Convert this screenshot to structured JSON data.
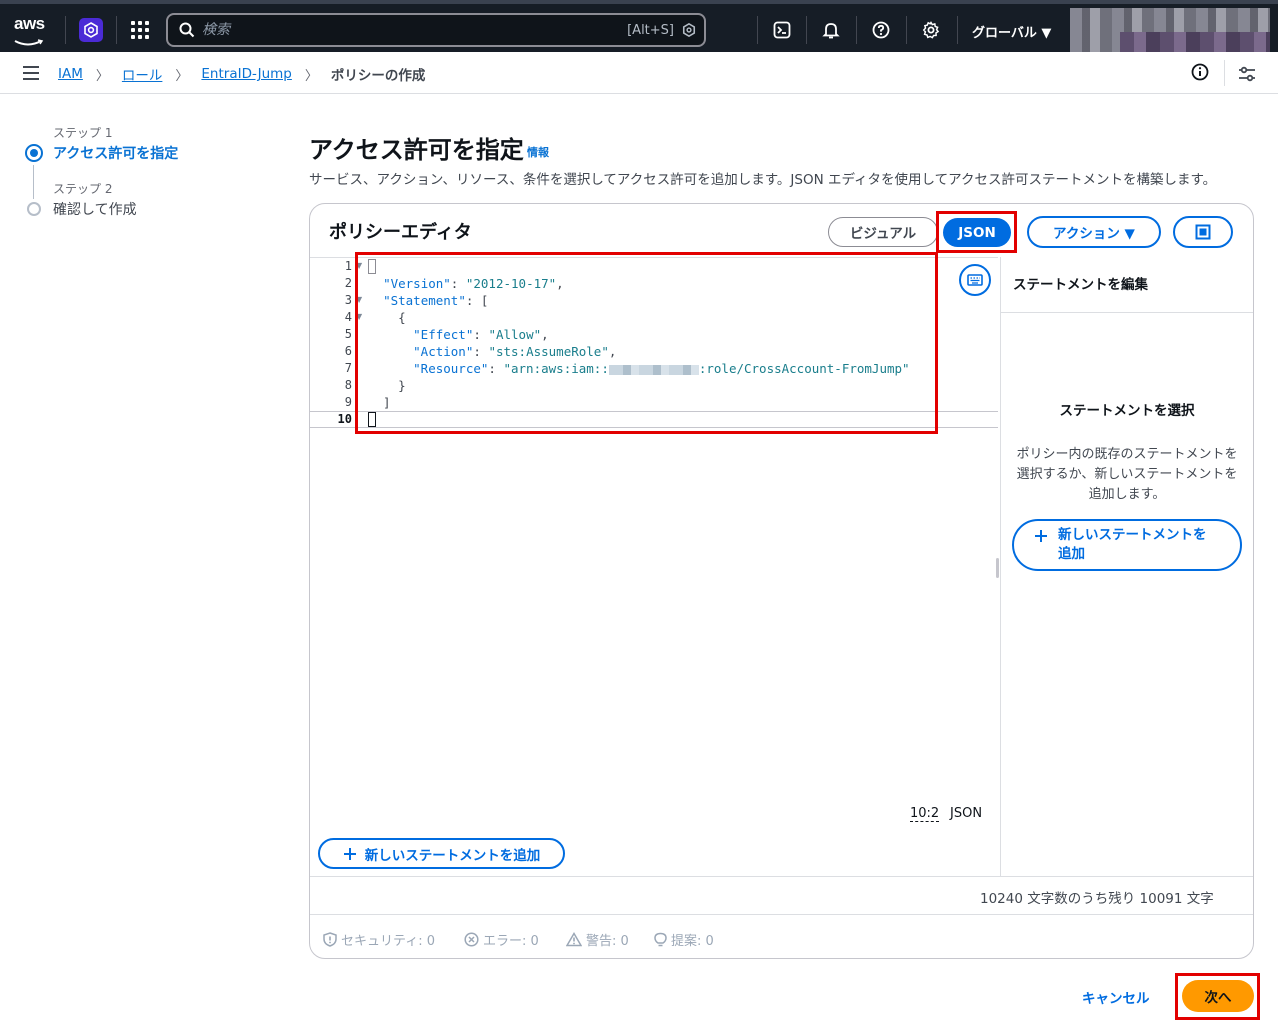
{
  "topnav": {
    "logo_text": "aws",
    "search_placeholder": "検索",
    "search_shortcut": "[Alt+S]",
    "region_label": "グローバル ▼"
  },
  "breadcrumb": {
    "items": [
      "IAM",
      "ロール",
      "EntraID-Jump"
    ],
    "current": "ポリシーの作成"
  },
  "steps": [
    {
      "number_label": "ステップ 1",
      "title": "アクセス許可を指定",
      "active": true
    },
    {
      "number_label": "ステップ 2",
      "title": "確認して作成",
      "active": false
    }
  ],
  "header": {
    "title": "アクセス許可を指定",
    "info_link": "情報",
    "description": "サービス、アクション、リソース、条件を選択してアクセス許可を追加します。JSON エディタを使用してアクセス許可ステートメントを構築します。"
  },
  "editor": {
    "heading": "ポリシーエディタ",
    "mode_visual": "ビジュアル",
    "mode_json": "JSON",
    "selected_mode": "JSON",
    "actions_label": "アクション ▼",
    "line_numbers": [
      "1",
      "2",
      "3",
      "4",
      "5",
      "6",
      "7",
      "8",
      "9",
      "10"
    ],
    "code": {
      "version_key": "\"Version\"",
      "version_val": "\"2012-10-17\"",
      "statement_key": "\"Statement\"",
      "effect_key": "\"Effect\"",
      "effect_val": "\"Allow\"",
      "action_key": "\"Action\"",
      "action_val": "\"sts:AssumeRole\"",
      "resource_key": "\"Resource\"",
      "resource_prefix": "\"arn:aws:iam::",
      "resource_suffix": ":role/CrossAccount-FromJump\""
    },
    "cursor_position": "10:2",
    "language": "JSON",
    "add_statement_label": "新しいステートメントを追加",
    "char_count": "10240 文字数のうち残り 10091 文字"
  },
  "right_panel": {
    "heading": "ステートメントを編集",
    "empty_title": "ステートメントを選択",
    "empty_desc": "ポリシー内の既存のステートメントを選択するか、新しいステートメントを追加します。",
    "add_label_line1": "新しいステートメントを",
    "add_label_line2": "追加"
  },
  "status": {
    "security": "セキュリティ: 0",
    "errors": "エラー: 0",
    "warnings": "警告: 0",
    "suggestions": "提案: 0"
  },
  "footer": {
    "cancel_label": "キャンセル",
    "next_label": "次へ"
  },
  "colors": {
    "primary": "#006ce0",
    "next_button": "#ff9900",
    "annotation": "#e20000",
    "nav_bg": "#161d26"
  }
}
